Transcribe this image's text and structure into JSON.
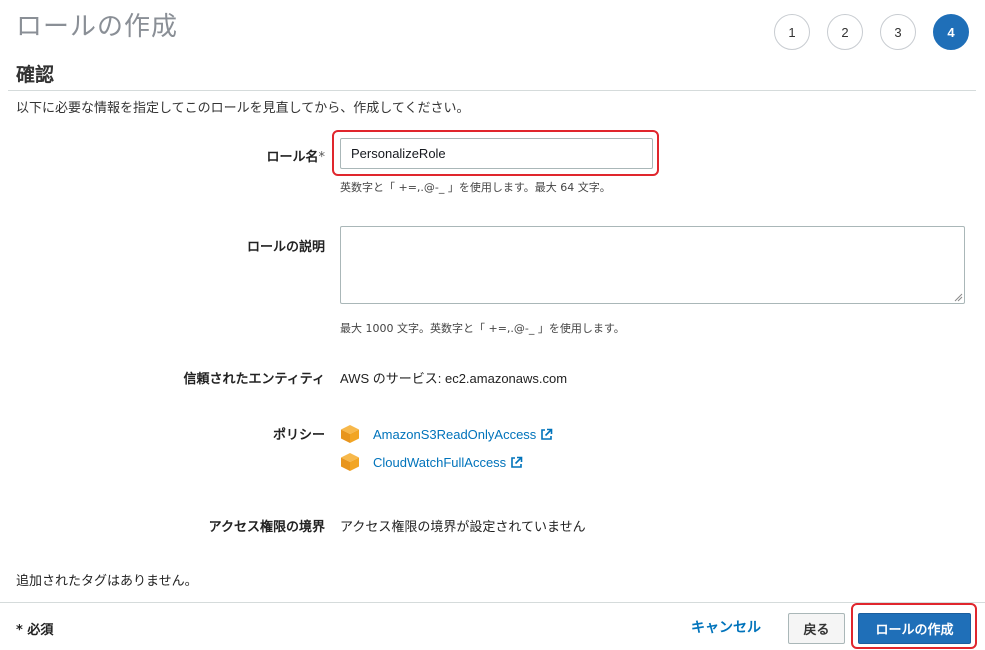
{
  "header": {
    "title": "ロールの作成",
    "steps": [
      {
        "label": "1",
        "active": false
      },
      {
        "label": "2",
        "active": false
      },
      {
        "label": "3",
        "active": false
      },
      {
        "label": "4",
        "active": true
      }
    ]
  },
  "section": {
    "title": "確認",
    "intro": "以下に必要な情報を指定してこのロールを見直してから、作成してください。"
  },
  "form": {
    "role_name": {
      "label": "ロール名",
      "required_mark": "*",
      "value": "PersonalizeRole",
      "hint": "英数字と「 +=,.@-_ 」を使用します。最大 64 文字。"
    },
    "description": {
      "label": "ロールの説明",
      "value": "",
      "hint": "最大 1000 文字。英数字と「 +=,.@-_ 」を使用します。"
    },
    "trusted_entity": {
      "label": "信頼されたエンティティ",
      "value": "AWS のサービス: ec2.amazonaws.com"
    },
    "policies": {
      "label": "ポリシー",
      "items": [
        {
          "name": "AmazonS3ReadOnlyAccess",
          "icon": "aws-cube-icon"
        },
        {
          "name": "CloudWatchFullAccess",
          "icon": "aws-cube-icon"
        }
      ]
    },
    "boundary": {
      "label": "アクセス権限の境界",
      "value": "アクセス権限の境界が設定されていません"
    }
  },
  "tags": {
    "note": "追加されたタグはありません。"
  },
  "footer": {
    "required_note": "* 必須",
    "cancel_label": "キャンセル",
    "back_label": "戻る",
    "create_label": "ロールの作成"
  },
  "colors": {
    "accent": "#1f6fb8",
    "link": "#0073bb",
    "highlight": "#e0262d",
    "cube": "#f2a524"
  }
}
